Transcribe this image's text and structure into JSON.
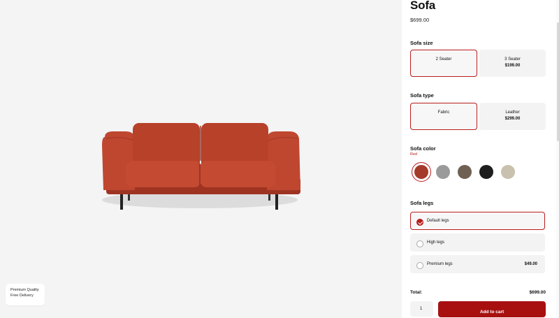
{
  "product": {
    "title": "Sofa",
    "price": "$699.00"
  },
  "badge": {
    "line1": "Premium Quality",
    "line2": "Free Delivery"
  },
  "size": {
    "label": "Sofa size",
    "options": [
      {
        "name": "2 Seater",
        "extra": "",
        "selected": true
      },
      {
        "name": "3 Seater",
        "extra": "$199.00",
        "selected": false
      }
    ]
  },
  "type": {
    "label": "Sofa type",
    "options": [
      {
        "name": "Fabric",
        "extra": "",
        "selected": true
      },
      {
        "name": "Leather",
        "extra": "$299.00",
        "selected": false
      }
    ]
  },
  "color": {
    "label": "Sofa color",
    "selected_name": "Red",
    "swatches": [
      {
        "color": "#a33a2a",
        "selected": true
      },
      {
        "color": "#9a9a9a",
        "selected": false
      },
      {
        "color": "#6e6154",
        "selected": false
      },
      {
        "color": "#1e1e1e",
        "selected": false
      },
      {
        "color": "#c9c0ae",
        "selected": false
      }
    ]
  },
  "legs": {
    "label": "Sofa legs",
    "options": [
      {
        "name": "Default legs",
        "price": "",
        "selected": true
      },
      {
        "name": "High legs",
        "price": "",
        "selected": false
      },
      {
        "name": "Premium legs",
        "price": "$49.00",
        "selected": false
      }
    ]
  },
  "footer": {
    "total_label": "Total:",
    "total_value": "$699.00",
    "quantity": "1",
    "cart_label": "Add to cart"
  },
  "colors": {
    "accent": "#a81010",
    "sofa": "#b8412a"
  }
}
